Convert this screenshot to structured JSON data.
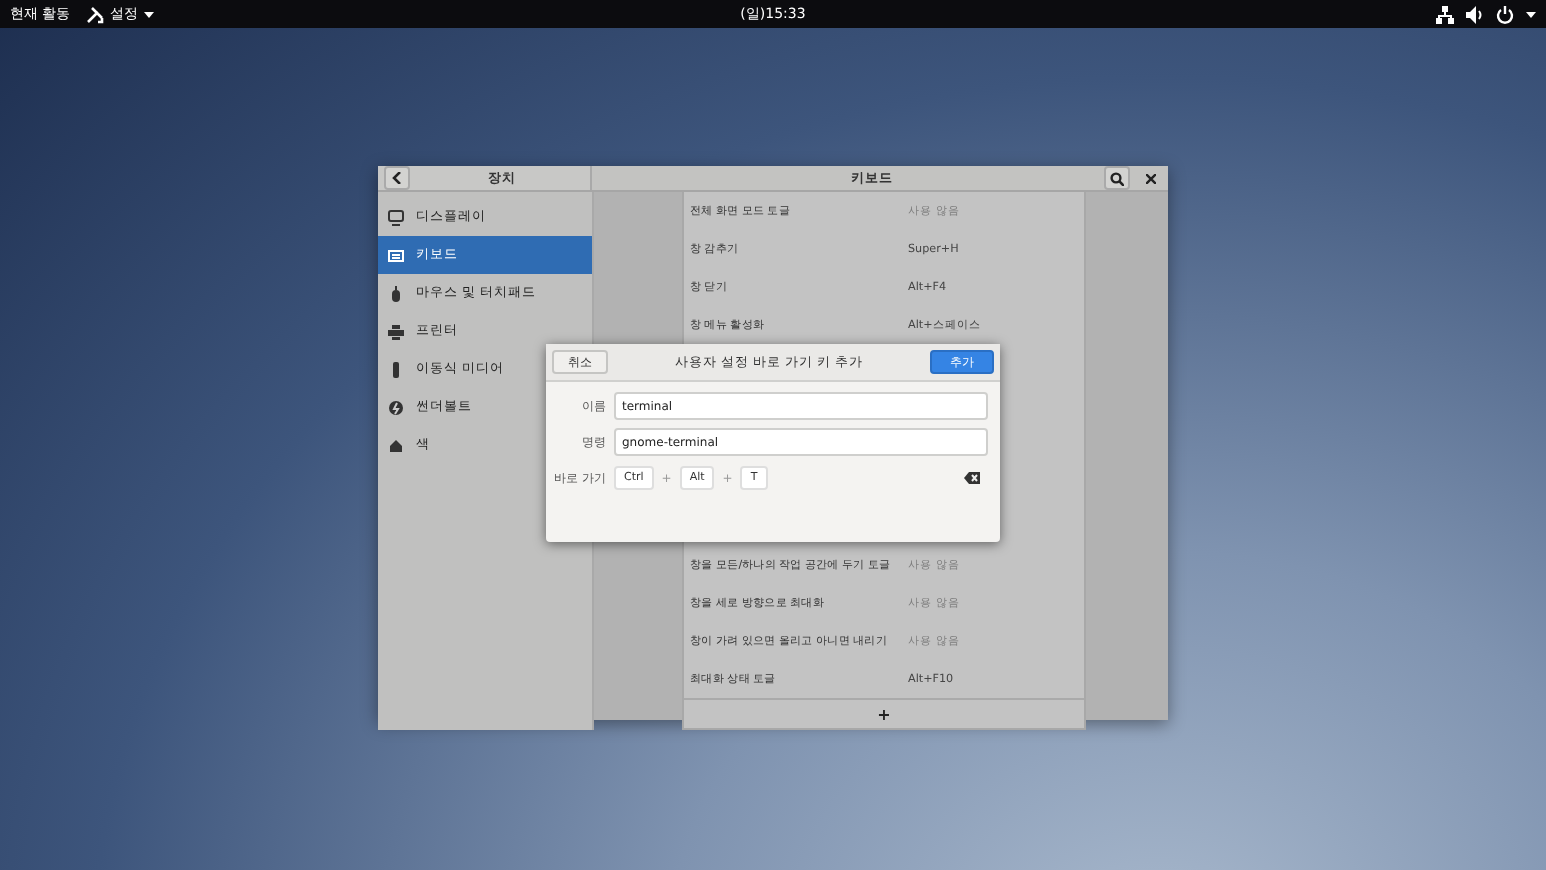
{
  "top_bar": {
    "activities": "현재 활동",
    "app_menu": "설정",
    "clock": "(일)15:33"
  },
  "window": {
    "sidebar_title": "장치",
    "title": "키보드",
    "sidebar": {
      "items": [
        {
          "label": "디스플레이",
          "selected": false
        },
        {
          "label": "키보드",
          "selected": true
        },
        {
          "label": "마우스 및 터치패드",
          "selected": false
        },
        {
          "label": "프린터",
          "selected": false
        },
        {
          "label": "이동식 미디어",
          "selected": false
        },
        {
          "label": "썬더볼트",
          "selected": false
        },
        {
          "label": "색",
          "selected": false
        }
      ]
    },
    "shortcuts_top": [
      {
        "name": "전체 화면 모드 토글",
        "shortcut": "사용 않음",
        "disabled": true
      },
      {
        "name": "창 감추기",
        "shortcut": "Super+H",
        "disabled": false
      },
      {
        "name": "창 닫기",
        "shortcut": "Alt+F4",
        "disabled": false
      },
      {
        "name": "창 메뉴 활성화",
        "shortcut": "Alt+스페이스",
        "disabled": false
      }
    ],
    "shortcuts_bottom": [
      {
        "name": "창을 모든/하나의 작업 공간에 두기 토글",
        "shortcut": "사용 않음",
        "disabled": true
      },
      {
        "name": "창을 세로 방향으로 최대화",
        "shortcut": "사용 않음",
        "disabled": true
      },
      {
        "name": "창이 가려 있으면 올리고 아니면 내리기",
        "shortcut": "사용 않음",
        "disabled": true
      },
      {
        "name": "최대화 상태 토글",
        "shortcut": "Alt+F10",
        "disabled": false
      }
    ],
    "add_button": "+"
  },
  "dialog": {
    "cancel": "취소",
    "title": "사용자 설정 바로 가기 키 추가",
    "add": "추가",
    "name_label": "이름",
    "name_value": "terminal",
    "command_label": "명령",
    "command_value": "gnome-terminal",
    "shortcut_label": "바로 가기",
    "keys": [
      "Ctrl",
      "Alt",
      "T"
    ],
    "separator": "+"
  }
}
